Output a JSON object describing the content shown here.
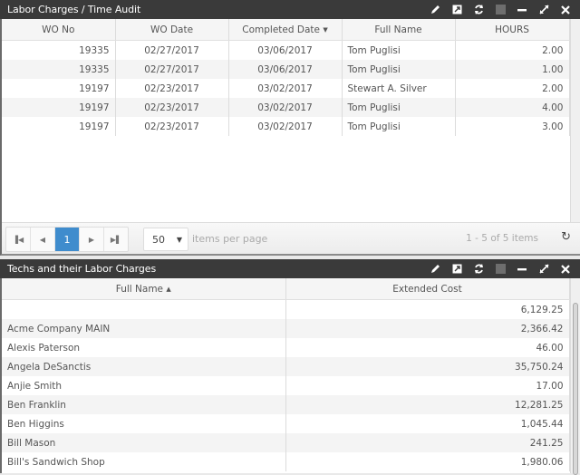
{
  "panel1": {
    "title": "Labor Charges / Time Audit",
    "columns": [
      {
        "label": "WO No",
        "sort": ""
      },
      {
        "label": "WO Date",
        "sort": ""
      },
      {
        "label": "Completed Date",
        "sort": "▼"
      },
      {
        "label": "Full Name",
        "sort": ""
      },
      {
        "label": "HOURS",
        "sort": ""
      }
    ],
    "rows": [
      {
        "wo_no": "19335",
        "wo_date": "02/27/2017",
        "completed_date": "03/06/2017",
        "full_name": "Tom Puglisi",
        "hours": "2.00"
      },
      {
        "wo_no": "19335",
        "wo_date": "02/27/2017",
        "completed_date": "03/06/2017",
        "full_name": "Tom Puglisi",
        "hours": "1.00"
      },
      {
        "wo_no": "19197",
        "wo_date": "02/23/2017",
        "completed_date": "03/02/2017",
        "full_name": "Stewart A. Silver",
        "hours": "2.00"
      },
      {
        "wo_no": "19197",
        "wo_date": "02/23/2017",
        "completed_date": "03/02/2017",
        "full_name": "Tom Puglisi",
        "hours": "4.00"
      },
      {
        "wo_no": "19197",
        "wo_date": "02/23/2017",
        "completed_date": "03/02/2017",
        "full_name": "Tom Puglisi",
        "hours": "3.00"
      }
    ],
    "pager": {
      "first_icon": "first-page-icon",
      "prev_icon": "prev-page-icon",
      "current_page": "1",
      "next_icon": "next-page-icon",
      "last_icon": "last-page-icon",
      "page_size": "50",
      "page_size_label": "items per page",
      "info": "1 - 5 of 5 items",
      "refresh_icon": "refresh-icon"
    }
  },
  "panel2": {
    "title": "Techs and their Labor Charges",
    "columns": [
      {
        "label": "Full Name",
        "sort": "▲"
      },
      {
        "label": "Extended Cost",
        "sort": ""
      }
    ],
    "rows": [
      {
        "full_name": "",
        "extended_cost": "6,129.25"
      },
      {
        "full_name": "Acme Company MAIN",
        "extended_cost": "2,366.42"
      },
      {
        "full_name": "Alexis Paterson",
        "extended_cost": "46.00"
      },
      {
        "full_name": "Angela DeSanctis",
        "extended_cost": "35,750.24"
      },
      {
        "full_name": "Anjie Smith",
        "extended_cost": "17.00"
      },
      {
        "full_name": "Ben Franklin",
        "extended_cost": "12,281.25"
      },
      {
        "full_name": "Ben Higgins",
        "extended_cost": "1,045.44"
      },
      {
        "full_name": "Bill Mason",
        "extended_cost": "241.25"
      },
      {
        "full_name": "Bill's Sandwich Shop",
        "extended_cost": "1,980.06"
      }
    ]
  },
  "toolbar_icons": [
    "edit-icon",
    "export-icon",
    "refresh-icon",
    "color-box-icon",
    "minimize-icon",
    "maximize-icon",
    "close-icon"
  ],
  "colors": {
    "titlebar": "#3a3a3a",
    "accent": "#3f8ccd"
  }
}
